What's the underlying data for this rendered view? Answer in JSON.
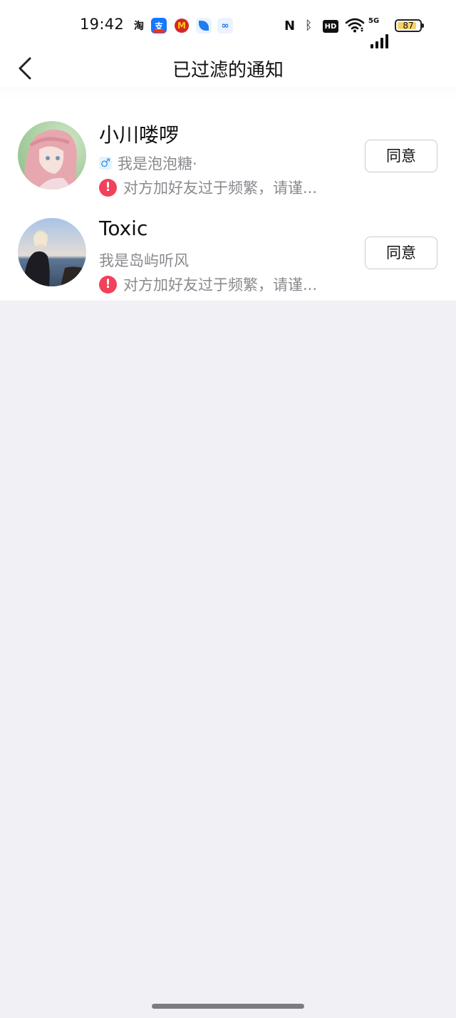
{
  "status_bar": {
    "time": "19:42",
    "app_icons": [
      "taobao-icon",
      "alipay-icon",
      "mcdonalds-icon",
      "feather-app-icon",
      "baidu-netdisk-icon"
    ],
    "taobao_glyph": "淘",
    "alipay_glyph": "支",
    "mcd_glyph": "M",
    "baidu_glyph": "∞",
    "system_icons": [
      "nfc-icon",
      "bluetooth-icon",
      "hd-icon",
      "wifi-icon",
      "5g-signal-icon",
      "battery-icon"
    ],
    "nfc_glyph": "N",
    "bluetooth_glyph": "ᛒ",
    "hd_label": "HD",
    "network": "5G",
    "battery": "87",
    "battery_level": 0.87,
    "battery_color": "#f5d36b"
  },
  "nav": {
    "title": "已过滤的通知",
    "back_icon": "chevron-left-icon"
  },
  "notifications": [
    {
      "name": "小川喽啰",
      "gender_icon": "male-icon",
      "gender_glyph": "♂",
      "message": "我是泡泡糖·",
      "warning": "对方加好友过于频繁，请谨...",
      "warning_icon": "exclamation-icon",
      "warning_glyph": "!",
      "button": "同意"
    },
    {
      "name": "Toxic",
      "message": "我是岛屿听风",
      "warning": "对方加好友过于频繁，请谨...",
      "warning_icon": "exclamation-icon",
      "warning_glyph": "!",
      "button": "同意"
    }
  ],
  "colors": {
    "page_background": "#f0f0f5",
    "warning": "#f2415a",
    "male": "#2e9af0",
    "secondary_text": "#8a8a8f"
  }
}
